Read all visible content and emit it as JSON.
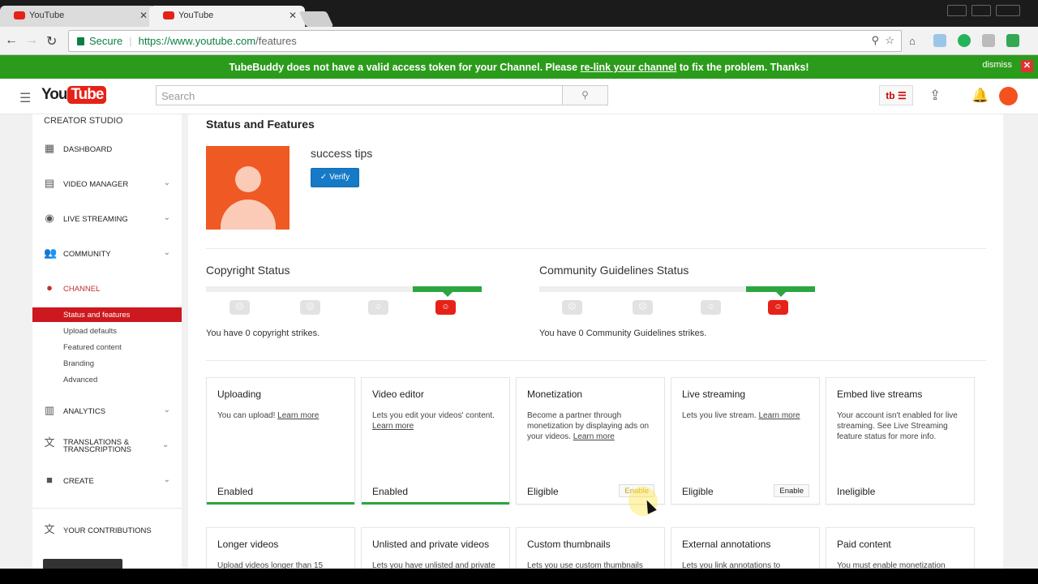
{
  "browser": {
    "tabs": [
      {
        "title": "YouTube"
      },
      {
        "title": "YouTube"
      }
    ],
    "secure_label": "Secure",
    "url_host": "https://www.youtube.com",
    "url_path": "/features"
  },
  "banner": {
    "text_before": "TubeBuddy does not have a valid access token for your Channel. Please ",
    "link": "re-link your channel",
    "text_after": " to fix the problem. Thanks!",
    "dismiss": "dismiss"
  },
  "header": {
    "logo_you": "You",
    "logo_tube": "Tube",
    "search_placeholder": "Search"
  },
  "sidebar": {
    "title": "CREATOR STUDIO",
    "items": [
      {
        "label": "DASHBOARD"
      },
      {
        "label": "VIDEO MANAGER"
      },
      {
        "label": "LIVE STREAMING"
      },
      {
        "label": "COMMUNITY"
      },
      {
        "label": "CHANNEL"
      },
      {
        "label": "ANALYTICS"
      },
      {
        "label": "TRANSLATIONS & TRANSCRIPTIONS"
      },
      {
        "label": "CREATE"
      },
      {
        "label": "YOUR CONTRIBUTIONS"
      }
    ],
    "channel_sub": [
      {
        "label": "Status and features"
      },
      {
        "label": "Upload defaults"
      },
      {
        "label": "Featured content"
      },
      {
        "label": "Branding"
      },
      {
        "label": "Advanced"
      }
    ]
  },
  "main": {
    "title": "Status and Features",
    "channel_name": "success tips",
    "verify_label": "Verify",
    "copyright": {
      "title": "Copyright Status",
      "text": "You have 0 copyright strikes."
    },
    "community": {
      "title": "Community Guidelines Status",
      "text": "You have 0 Community Guidelines strikes."
    },
    "features": [
      {
        "title": "Uploading",
        "desc": "You can upload! ",
        "link": "Learn more",
        "status": "Enabled",
        "button": ""
      },
      {
        "title": "Video editor",
        "desc": "Lets you edit your videos' content. ",
        "link": "Learn more",
        "status": "Enabled",
        "button": ""
      },
      {
        "title": "Monetization",
        "desc": "Become a partner through monetization by displaying ads on your videos. ",
        "link": "Learn more",
        "status": "Eligible",
        "button": "Enable"
      },
      {
        "title": "Live streaming",
        "desc": "Lets you live stream. ",
        "link": "Learn more",
        "status": "Eligible",
        "button": "Enable"
      },
      {
        "title": "Embed live streams",
        "desc": "Your account isn't enabled for live streaming. See Live Streaming feature status for more info.",
        "link": "",
        "status": "Ineligible",
        "button": ""
      },
      {
        "title": "Longer videos",
        "desc": "Upload videos longer than 15",
        "link": "",
        "status": "",
        "button": ""
      },
      {
        "title": "Unlisted and private videos",
        "desc": "Lets you have unlisted and private",
        "link": "",
        "status": "",
        "button": ""
      },
      {
        "title": "Custom thumbnails",
        "desc": "Lets you use custom thumbnails",
        "link": "",
        "status": "",
        "button": ""
      },
      {
        "title": "External annotations",
        "desc": "Lets you link annotations to",
        "link": "",
        "status": "",
        "button": ""
      },
      {
        "title": "Paid content",
        "desc": "You must enable monetization",
        "link": "",
        "status": "",
        "button": ""
      }
    ]
  }
}
